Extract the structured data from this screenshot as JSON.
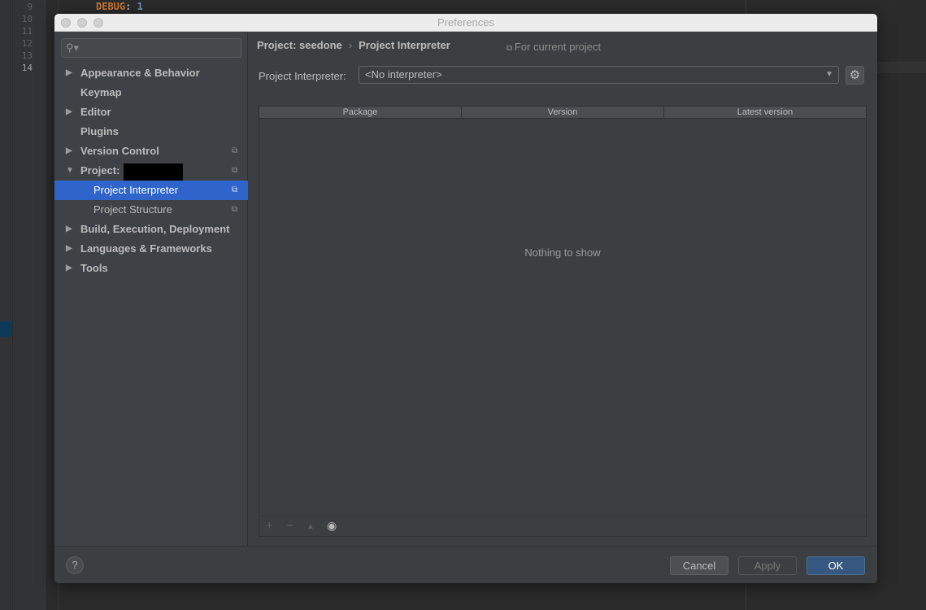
{
  "editor": {
    "line_numbers": [
      "9",
      "10",
      "11",
      "12",
      "13",
      "14"
    ],
    "code_key": "DEBUG",
    "code_value": "1"
  },
  "dialog": {
    "title": "Preferences",
    "search_placeholder": "",
    "sidebar": {
      "items": [
        {
          "label": "Appearance & Behavior",
          "expandable": true
        },
        {
          "label": "Keymap",
          "expandable": false
        },
        {
          "label": "Editor",
          "expandable": true
        },
        {
          "label": "Plugins",
          "expandable": false
        },
        {
          "label": "Version Control",
          "expandable": true
        },
        {
          "label": "Project:",
          "expandable": true,
          "expanded": true
        },
        {
          "label": "Project Interpreter",
          "selected": true
        },
        {
          "label": "Project Structure"
        },
        {
          "label": "Build, Execution, Deployment",
          "expandable": true
        },
        {
          "label": "Languages & Frameworks",
          "expandable": true
        },
        {
          "label": "Tools",
          "expandable": true
        }
      ]
    },
    "breadcrumb": {
      "project": "Project: seedone",
      "separator": "›",
      "page": "Project Interpreter"
    },
    "scope_note": "For current project",
    "interpreter_label": "Project Interpreter:",
    "interpreter_value": "<No interpreter>",
    "table": {
      "columns": [
        "Package",
        "Version",
        "Latest version"
      ],
      "empty_text": "Nothing to show"
    },
    "footer": {
      "help": "?",
      "cancel": "Cancel",
      "apply": "Apply",
      "ok": "OK"
    },
    "colors": {
      "selection": "#2f65ca",
      "ok_button": "#365880",
      "keyword": "#cc7832"
    }
  }
}
